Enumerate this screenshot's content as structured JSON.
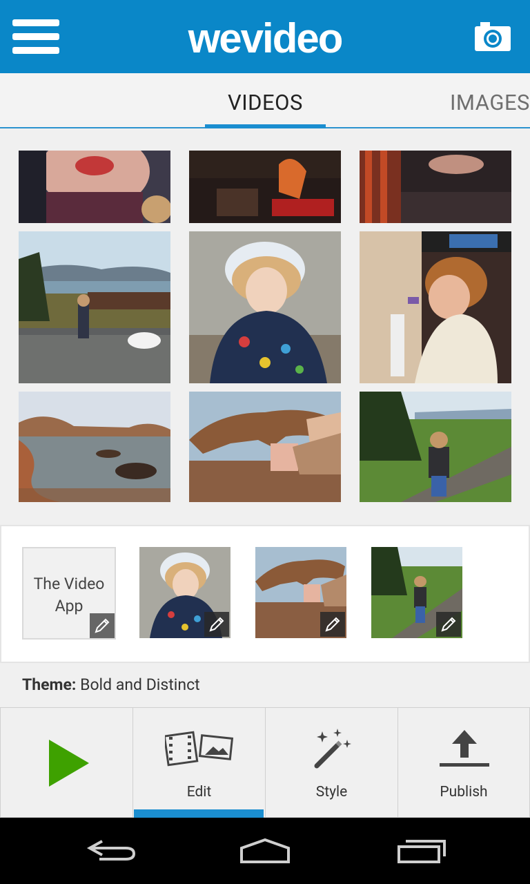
{
  "app": {
    "brand": "wevideo"
  },
  "tabs": {
    "videos": "VIDEOS",
    "images": "IMAGES"
  },
  "timeline": {
    "title_clip_text": "The Video App"
  },
  "theme": {
    "label": "Theme:",
    "value": "Bold and Distinct"
  },
  "actions": {
    "edit": "Edit",
    "style": "Style",
    "publish": "Publish"
  },
  "colors": {
    "brand_blue": "#0a87c8",
    "accent_blue": "#1b8ed0",
    "play_green": "#3ea100"
  },
  "icons": {
    "menu": "hamburger-menu-icon",
    "camera": "camera-icon",
    "play": "play-icon",
    "edit": "film-and-photo-icon",
    "style": "magic-wand-icon",
    "publish": "upload-icon",
    "back": "back-icon",
    "home": "home-icon",
    "recents": "recent-apps-icon",
    "edit_badge": "pencil-icon"
  }
}
